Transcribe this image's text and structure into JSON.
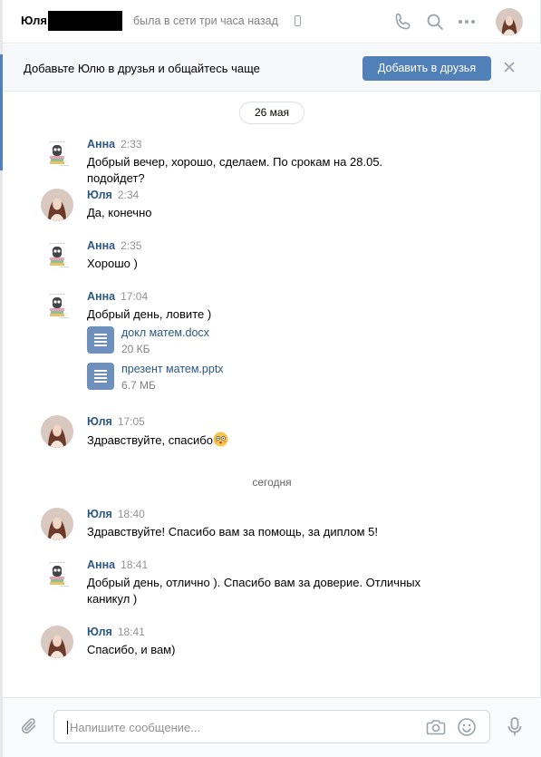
{
  "header": {
    "name": "Юля",
    "status": "была в сети три часа назад",
    "icons": [
      "phone-call-icon",
      "search-icon",
      "more-icon"
    ]
  },
  "friendbar": {
    "text": "Добавьте Юлю в друзья и общайтесь чаще",
    "button": "Добавить в друзья"
  },
  "dates": {
    "first": "26 мая",
    "today": "сегодня"
  },
  "messages": [
    {
      "author": "Анна",
      "time": "2:33",
      "text": "Добрый вечер, хорошо, сделаем. По срокам на 28.05. подойдет?"
    },
    {
      "author": "Юля",
      "time": "2:34",
      "text": "Да, конечно"
    },
    {
      "author": "Анна",
      "time": "2:35",
      "text": "Хорошо )"
    },
    {
      "author": "Анна",
      "time": "17:04",
      "text": "Добрый день, ловите )",
      "attachments": [
        {
          "name": "докл матем.docx",
          "size": "20 КБ"
        },
        {
          "name": "презент матем.pptx",
          "size": "6.7 МБ"
        }
      ]
    },
    {
      "author": "Юля",
      "time": "17:05",
      "text": "Здравствуйте, спасибо"
    },
    {
      "author": "Юля",
      "time": "18:40",
      "text": "Здравствуйте! Спасибо вам за помощь, за диплом 5!"
    },
    {
      "author": "Анна",
      "time": "18:41",
      "text": "Добрый день, отлично ). Спасибо вам за доверие. Отличных каникул )"
    },
    {
      "author": "Юля",
      "time": "18:41",
      "text": "Спасибо, и вам)"
    }
  ],
  "composer": {
    "placeholder": "Напишите сообщение..."
  },
  "colors": {
    "accent": "#5181b8",
    "link": "#2a5885"
  }
}
